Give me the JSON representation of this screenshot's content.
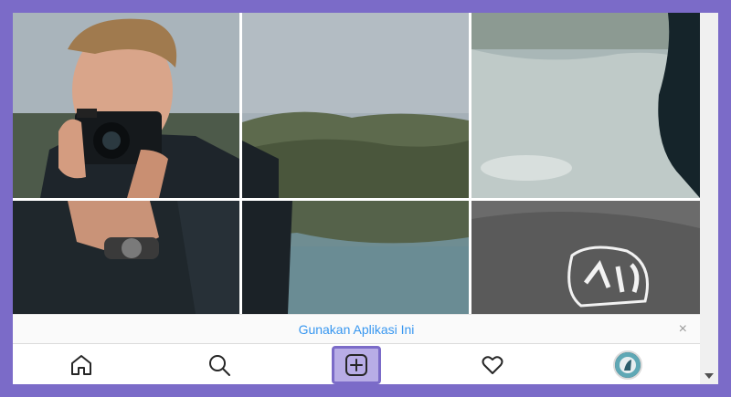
{
  "banner": {
    "link_text": "Gunakan Aplikasi Ini",
    "close_glyph": "×"
  },
  "grid": {
    "tiles": [
      {
        "content": "photographer-with-camera-top-left"
      },
      {
        "content": "coastal-cliffs-top-center"
      },
      {
        "content": "beach-waves-top-right"
      },
      {
        "content": "photographer-hand-watch-bottom-left"
      },
      {
        "content": "sea-water-bottom-center"
      },
      {
        "content": "grey-sketch-bottom-right"
      }
    ]
  },
  "nav": {
    "items": [
      {
        "name": "home",
        "icon": "home-icon"
      },
      {
        "name": "search",
        "icon": "search-icon"
      },
      {
        "name": "new-post",
        "icon": "plus-square-icon"
      },
      {
        "name": "activity",
        "icon": "heart-icon"
      },
      {
        "name": "profile",
        "icon": "avatar"
      }
    ]
  },
  "colors": {
    "frame": "#7b6bc8",
    "link": "#3897f0",
    "highlight_fill": "#b8ade6"
  }
}
